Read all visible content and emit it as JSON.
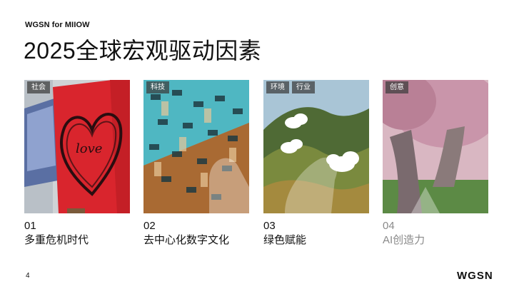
{
  "header": {
    "brand": "WGSN for MIIOW",
    "title": "2025全球宏观驱动因素"
  },
  "cards": [
    {
      "tags": [
        "社会"
      ],
      "num": "01",
      "label": "多重危机时代",
      "image": "love-heart-sign-photo"
    },
    {
      "tags": [
        "科技"
      ],
      "num": "02",
      "label": "去中心化数字文化",
      "image": "digital-blocks-render"
    },
    {
      "tags": [
        "环境",
        "行业"
      ],
      "num": "03",
      "label": "绿色赋能",
      "image": "green-hills-clouds-render"
    },
    {
      "tags": [
        "创意"
      ],
      "num": "04",
      "label": "AI创造力",
      "image": "pink-tree-render"
    }
  ],
  "footer": {
    "page": "4",
    "logo": "WGSN"
  },
  "colors": {
    "accent_muted": "#8a8a8a",
    "text": "#111111"
  }
}
